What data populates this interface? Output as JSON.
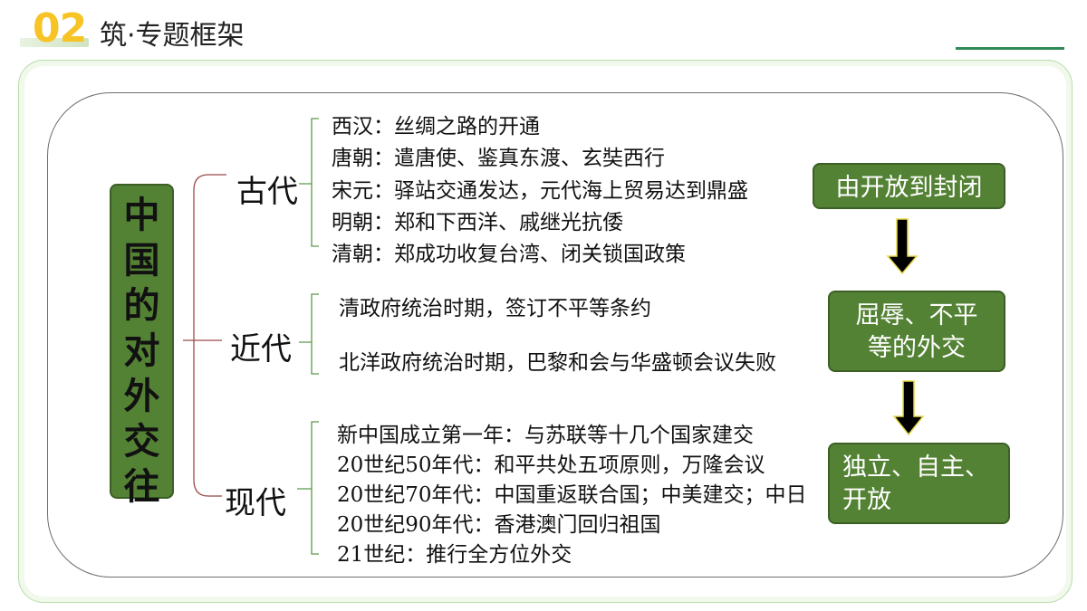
{
  "header": {
    "number": "02",
    "title": "筑·专题框架"
  },
  "root": {
    "label": "中国的对外交往"
  },
  "eras": [
    {
      "label": "古代",
      "items": [
        "西汉：丝绸之路的开通",
        "唐朝：遣唐使、鉴真东渡、玄奘西行",
        "宋元：驿站交通发达，元代海上贸易达到鼎盛",
        "明朝：郑和下西洋、戚继光抗倭",
        "清朝：郑成功收复台湾、闭关锁国政策"
      ]
    },
    {
      "label": "近代",
      "items": [
        "清政府统治时期，签订不平等条约",
        "北洋政府统治时期，巴黎和会与华盛顿会议失败"
      ]
    },
    {
      "label": "现代",
      "items": [
        "新中国成立第一年：与苏联等十几个国家建交",
        "20世纪50年代：和平共处五项原则，万隆会议",
        "20世纪70年代：中国重返联合国；中美建交；中日",
        "20世纪90年代：香港澳门回归祖国",
        "21世纪：推行全方位外交"
      ]
    }
  ],
  "stages": [
    "由开放到封闭",
    "屈辱、不平等的外交",
    "独立、自主、开放"
  ],
  "colors": {
    "box_green": "#548235",
    "box_border": "#3c5f25",
    "accent_yellow": "#f7c325",
    "arrow_fill": "#000000",
    "arrow_outline": "#f2e34c"
  }
}
